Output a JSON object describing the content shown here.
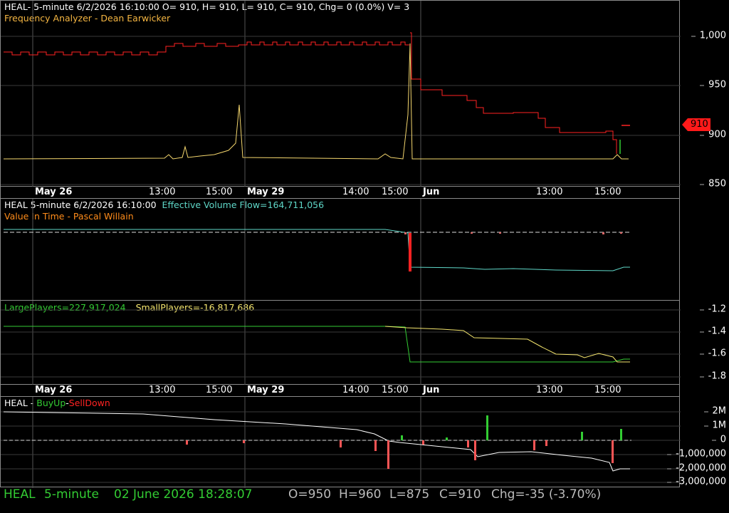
{
  "colors": {
    "green": "#33cc33",
    "red": "#ff2222",
    "yellow": "#f5d76e",
    "cyan": "#5fd7c8",
    "orange": "#ff8c1a",
    "white": "#ffffff",
    "grid": "#3a3a3a"
  },
  "panel1": {
    "header_line1": "HEAL- 5-minute 6/2/2026 16:10:00 O= 910, H= 910, L= 910, C= 910, Chg= 0 (0.0%) V= 3",
    "header_line2": "Frequency Analyzer - Dean Earwicker",
    "y_ticks": [
      "1,000",
      "950",
      "900",
      "850"
    ],
    "last_price_tag": "910"
  },
  "x_axis": {
    "labels": [
      {
        "text": "May 26",
        "major": true
      },
      {
        "text": "13:00",
        "major": false
      },
      {
        "text": "15:00",
        "major": false
      },
      {
        "text": "May 29",
        "major": true
      },
      {
        "text": "14:00",
        "major": false
      },
      {
        "text": "15:00",
        "major": false
      },
      {
        "text": "Jun",
        "major": true
      },
      {
        "text": "13:00",
        "major": false
      },
      {
        "text": "15:00",
        "major": false
      }
    ]
  },
  "panel2": {
    "ticker": "HEAL 5-minute  6/2/2026 16:10:00",
    "effective_volume_flow": "Effective Volume Flow=164,711,056",
    "indicator": "Value In Time - Pascal Willain"
  },
  "panel3": {
    "large_players": "LargePlayers=227,917,024",
    "small_players": "SmallPlayers=-16,817,686",
    "y_ticks": [
      "-1.2",
      "-1.4",
      "-1.6",
      "-1.8"
    ]
  },
  "panel4": {
    "ticker": "HEAL - ",
    "buy_up": "BuyUp",
    "dash": "-",
    "sell_down": "SellDown",
    "y_ticks": [
      "2M",
      "1M",
      "0",
      "-1,000,000",
      "-2,000,000",
      "-3,000,000"
    ]
  },
  "footer": {
    "symbol": "HEAL",
    "interval": "5-minute",
    "datetime": "02 June 2026 18:28:07",
    "open": "O=950",
    "high": "H=960",
    "low": "L=875",
    "close": "C=910",
    "change": "Chg=-35 (-3.70%)"
  }
}
